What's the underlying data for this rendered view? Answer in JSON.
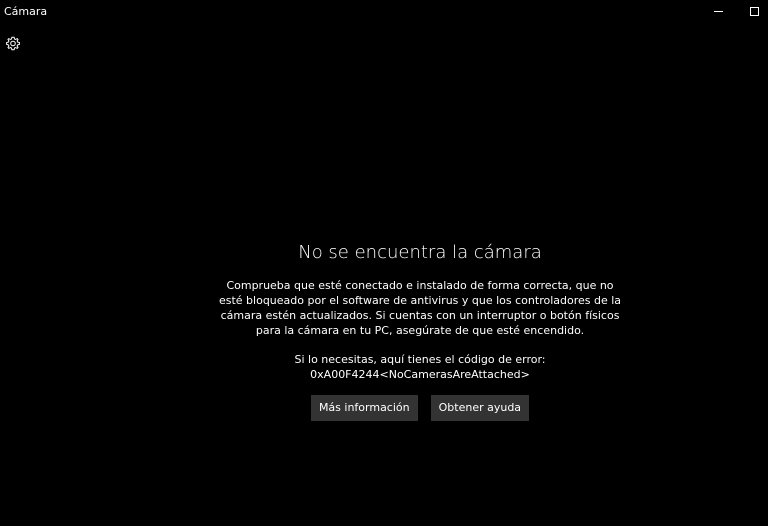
{
  "window": {
    "title": "Cámara",
    "minimize_icon": "minimize-icon",
    "maximize_icon": "maximize-icon"
  },
  "toolbar": {
    "settings_icon": "gear-icon"
  },
  "error": {
    "heading": "No se encuentra la cámara",
    "description": "Comprueba que esté conectado e instalado de forma correcta, que no esté bloqueado por el software de antivirus y que los controladores de la cámara estén actualizados. Si cuentas con un interruptor o botón físicos para la cámara en tu PC, asegúrate de que esté encendido.",
    "code_lead": "Si lo necesitas, aquí tienes el código de error:",
    "code": "0xA00F4244<NoCamerasAreAttached>"
  },
  "buttons": {
    "more_info": "Más información",
    "get_help": "Obtener ayuda"
  },
  "colors": {
    "background": "#000000",
    "text": "#ffffff",
    "button_bg": "#333333"
  }
}
